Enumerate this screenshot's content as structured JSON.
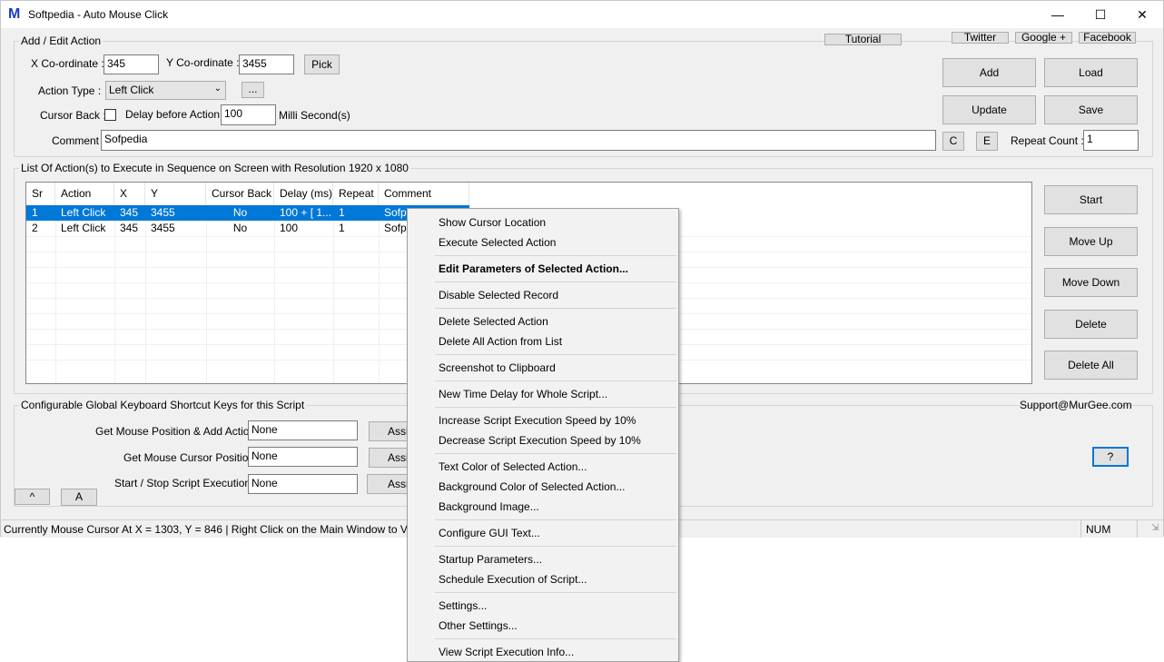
{
  "window": {
    "title": "Softpedia - Auto Mouse Click"
  },
  "add_edit": {
    "group_label": "Add / Edit Action",
    "x_label": "X Co-ordinate :",
    "x_value": "345",
    "y_label": "Y Co-ordinate :",
    "y_value": "3455",
    "pick": "Pick",
    "action_type_label": "Action Type :",
    "action_type_value": "Left Click",
    "more_button": "...",
    "cursor_back_label": "Cursor Back :",
    "delay_label": "Delay before Action :",
    "delay_value": "100",
    "delay_unit": "Milli Second(s)",
    "comment_label": "Comment :",
    "comment_value": "Sofpedia",
    "c_button": "C",
    "e_button": "E",
    "repeat_label": "Repeat Count :",
    "repeat_value": "1"
  },
  "top_links": {
    "tutorial": "Tutorial",
    "twitter": "Twitter",
    "google": "Google +",
    "facebook": "Facebook"
  },
  "right_buttons": {
    "add": "Add",
    "load": "Load",
    "update": "Update",
    "save": "Save"
  },
  "list": {
    "group_label": "List Of Action(s) to Execute in Sequence on Screen with Resolution 1920 x 1080",
    "columns": [
      "Sr",
      "Action",
      "X",
      "Y",
      "Cursor Back",
      "Delay (ms)",
      "Repeat",
      "Comment"
    ],
    "rows": [
      [
        "1",
        "Left Click",
        "345",
        "3455",
        "No",
        "100 + [ 1...",
        "1",
        "Sofpe"
      ],
      [
        "2",
        "Left Click",
        "345",
        "3455",
        "No",
        "100",
        "1",
        "Sofpe"
      ]
    ]
  },
  "side_buttons": {
    "start": "Start",
    "move_up": "Move Up",
    "move_down": "Move Down",
    "delete": "Delete",
    "delete_all": "Delete All"
  },
  "shortcuts": {
    "group_label": "Configurable Global Keyboard Shortcut Keys for this Script",
    "support": "Support@MurGee.com",
    "items": [
      {
        "label": "Get Mouse Position & Add Action :",
        "value": "None",
        "button": "Assi"
      },
      {
        "label": "Get Mouse Cursor Position :",
        "value": "None",
        "button": "Assi"
      },
      {
        "label": "Start / Stop Script Execution :",
        "value": "None",
        "button": "Assi"
      }
    ],
    "help": "?",
    "up_button": "^",
    "a_button": "A"
  },
  "status": {
    "text": "Currently Mouse Cursor At X = 1303, Y = 846 | Right Click on the Main Window to Vie",
    "num": "NUM"
  },
  "context_menu": [
    [
      "Show Cursor Location",
      "Execute Selected Action"
    ],
    [
      "Edit Parameters of Selected Action..."
    ],
    [
      "Disable Selected Record"
    ],
    [
      "Delete Selected Action",
      "Delete All Action from List"
    ],
    [
      "Screenshot to Clipboard"
    ],
    [
      "New Time Delay for Whole Script..."
    ],
    [
      "Increase Script Execution Speed by 10%",
      "Decrease Script Execution Speed by 10%"
    ],
    [
      "Text Color of Selected Action...",
      "Background Color of Selected Action...",
      "Background Image..."
    ],
    [
      "Configure GUI Text..."
    ],
    [
      "Startup Parameters...",
      "Schedule Execution of Script..."
    ],
    [
      "Settings...",
      "Other Settings..."
    ],
    [
      "View Script Execution Info..."
    ]
  ],
  "colors": {
    "selection": "#0078d7",
    "accent": "#1a3cc8"
  }
}
